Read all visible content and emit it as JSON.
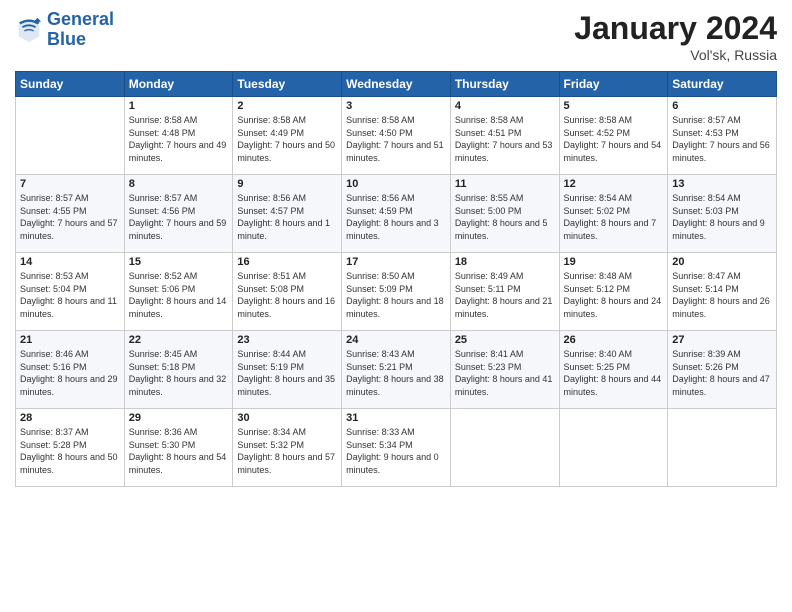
{
  "logo": {
    "line1": "General",
    "line2": "Blue"
  },
  "title": "January 2024",
  "subtitle": "Vol'sk, Russia",
  "days_header": [
    "Sunday",
    "Monday",
    "Tuesday",
    "Wednesday",
    "Thursday",
    "Friday",
    "Saturday"
  ],
  "weeks": [
    [
      {
        "day": "",
        "sunrise": "",
        "sunset": "",
        "daylight": ""
      },
      {
        "day": "1",
        "sunrise": "Sunrise: 8:58 AM",
        "sunset": "Sunset: 4:48 PM",
        "daylight": "Daylight: 7 hours and 49 minutes."
      },
      {
        "day": "2",
        "sunrise": "Sunrise: 8:58 AM",
        "sunset": "Sunset: 4:49 PM",
        "daylight": "Daylight: 7 hours and 50 minutes."
      },
      {
        "day": "3",
        "sunrise": "Sunrise: 8:58 AM",
        "sunset": "Sunset: 4:50 PM",
        "daylight": "Daylight: 7 hours and 51 minutes."
      },
      {
        "day": "4",
        "sunrise": "Sunrise: 8:58 AM",
        "sunset": "Sunset: 4:51 PM",
        "daylight": "Daylight: 7 hours and 53 minutes."
      },
      {
        "day": "5",
        "sunrise": "Sunrise: 8:58 AM",
        "sunset": "Sunset: 4:52 PM",
        "daylight": "Daylight: 7 hours and 54 minutes."
      },
      {
        "day": "6",
        "sunrise": "Sunrise: 8:57 AM",
        "sunset": "Sunset: 4:53 PM",
        "daylight": "Daylight: 7 hours and 56 minutes."
      }
    ],
    [
      {
        "day": "7",
        "sunrise": "Sunrise: 8:57 AM",
        "sunset": "Sunset: 4:55 PM",
        "daylight": "Daylight: 7 hours and 57 minutes."
      },
      {
        "day": "8",
        "sunrise": "Sunrise: 8:57 AM",
        "sunset": "Sunset: 4:56 PM",
        "daylight": "Daylight: 7 hours and 59 minutes."
      },
      {
        "day": "9",
        "sunrise": "Sunrise: 8:56 AM",
        "sunset": "Sunset: 4:57 PM",
        "daylight": "Daylight: 8 hours and 1 minute."
      },
      {
        "day": "10",
        "sunrise": "Sunrise: 8:56 AM",
        "sunset": "Sunset: 4:59 PM",
        "daylight": "Daylight: 8 hours and 3 minutes."
      },
      {
        "day": "11",
        "sunrise": "Sunrise: 8:55 AM",
        "sunset": "Sunset: 5:00 PM",
        "daylight": "Daylight: 8 hours and 5 minutes."
      },
      {
        "day": "12",
        "sunrise": "Sunrise: 8:54 AM",
        "sunset": "Sunset: 5:02 PM",
        "daylight": "Daylight: 8 hours and 7 minutes."
      },
      {
        "day": "13",
        "sunrise": "Sunrise: 8:54 AM",
        "sunset": "Sunset: 5:03 PM",
        "daylight": "Daylight: 8 hours and 9 minutes."
      }
    ],
    [
      {
        "day": "14",
        "sunrise": "Sunrise: 8:53 AM",
        "sunset": "Sunset: 5:04 PM",
        "daylight": "Daylight: 8 hours and 11 minutes."
      },
      {
        "day": "15",
        "sunrise": "Sunrise: 8:52 AM",
        "sunset": "Sunset: 5:06 PM",
        "daylight": "Daylight: 8 hours and 14 minutes."
      },
      {
        "day": "16",
        "sunrise": "Sunrise: 8:51 AM",
        "sunset": "Sunset: 5:08 PM",
        "daylight": "Daylight: 8 hours and 16 minutes."
      },
      {
        "day": "17",
        "sunrise": "Sunrise: 8:50 AM",
        "sunset": "Sunset: 5:09 PM",
        "daylight": "Daylight: 8 hours and 18 minutes."
      },
      {
        "day": "18",
        "sunrise": "Sunrise: 8:49 AM",
        "sunset": "Sunset: 5:11 PM",
        "daylight": "Daylight: 8 hours and 21 minutes."
      },
      {
        "day": "19",
        "sunrise": "Sunrise: 8:48 AM",
        "sunset": "Sunset: 5:12 PM",
        "daylight": "Daylight: 8 hours and 24 minutes."
      },
      {
        "day": "20",
        "sunrise": "Sunrise: 8:47 AM",
        "sunset": "Sunset: 5:14 PM",
        "daylight": "Daylight: 8 hours and 26 minutes."
      }
    ],
    [
      {
        "day": "21",
        "sunrise": "Sunrise: 8:46 AM",
        "sunset": "Sunset: 5:16 PM",
        "daylight": "Daylight: 8 hours and 29 minutes."
      },
      {
        "day": "22",
        "sunrise": "Sunrise: 8:45 AM",
        "sunset": "Sunset: 5:18 PM",
        "daylight": "Daylight: 8 hours and 32 minutes."
      },
      {
        "day": "23",
        "sunrise": "Sunrise: 8:44 AM",
        "sunset": "Sunset: 5:19 PM",
        "daylight": "Daylight: 8 hours and 35 minutes."
      },
      {
        "day": "24",
        "sunrise": "Sunrise: 8:43 AM",
        "sunset": "Sunset: 5:21 PM",
        "daylight": "Daylight: 8 hours and 38 minutes."
      },
      {
        "day": "25",
        "sunrise": "Sunrise: 8:41 AM",
        "sunset": "Sunset: 5:23 PM",
        "daylight": "Daylight: 8 hours and 41 minutes."
      },
      {
        "day": "26",
        "sunrise": "Sunrise: 8:40 AM",
        "sunset": "Sunset: 5:25 PM",
        "daylight": "Daylight: 8 hours and 44 minutes."
      },
      {
        "day": "27",
        "sunrise": "Sunrise: 8:39 AM",
        "sunset": "Sunset: 5:26 PM",
        "daylight": "Daylight: 8 hours and 47 minutes."
      }
    ],
    [
      {
        "day": "28",
        "sunrise": "Sunrise: 8:37 AM",
        "sunset": "Sunset: 5:28 PM",
        "daylight": "Daylight: 8 hours and 50 minutes."
      },
      {
        "day": "29",
        "sunrise": "Sunrise: 8:36 AM",
        "sunset": "Sunset: 5:30 PM",
        "daylight": "Daylight: 8 hours and 54 minutes."
      },
      {
        "day": "30",
        "sunrise": "Sunrise: 8:34 AM",
        "sunset": "Sunset: 5:32 PM",
        "daylight": "Daylight: 8 hours and 57 minutes."
      },
      {
        "day": "31",
        "sunrise": "Sunrise: 8:33 AM",
        "sunset": "Sunset: 5:34 PM",
        "daylight": "Daylight: 9 hours and 0 minutes."
      },
      {
        "day": "",
        "sunrise": "",
        "sunset": "",
        "daylight": ""
      },
      {
        "day": "",
        "sunrise": "",
        "sunset": "",
        "daylight": ""
      },
      {
        "day": "",
        "sunrise": "",
        "sunset": "",
        "daylight": ""
      }
    ]
  ]
}
